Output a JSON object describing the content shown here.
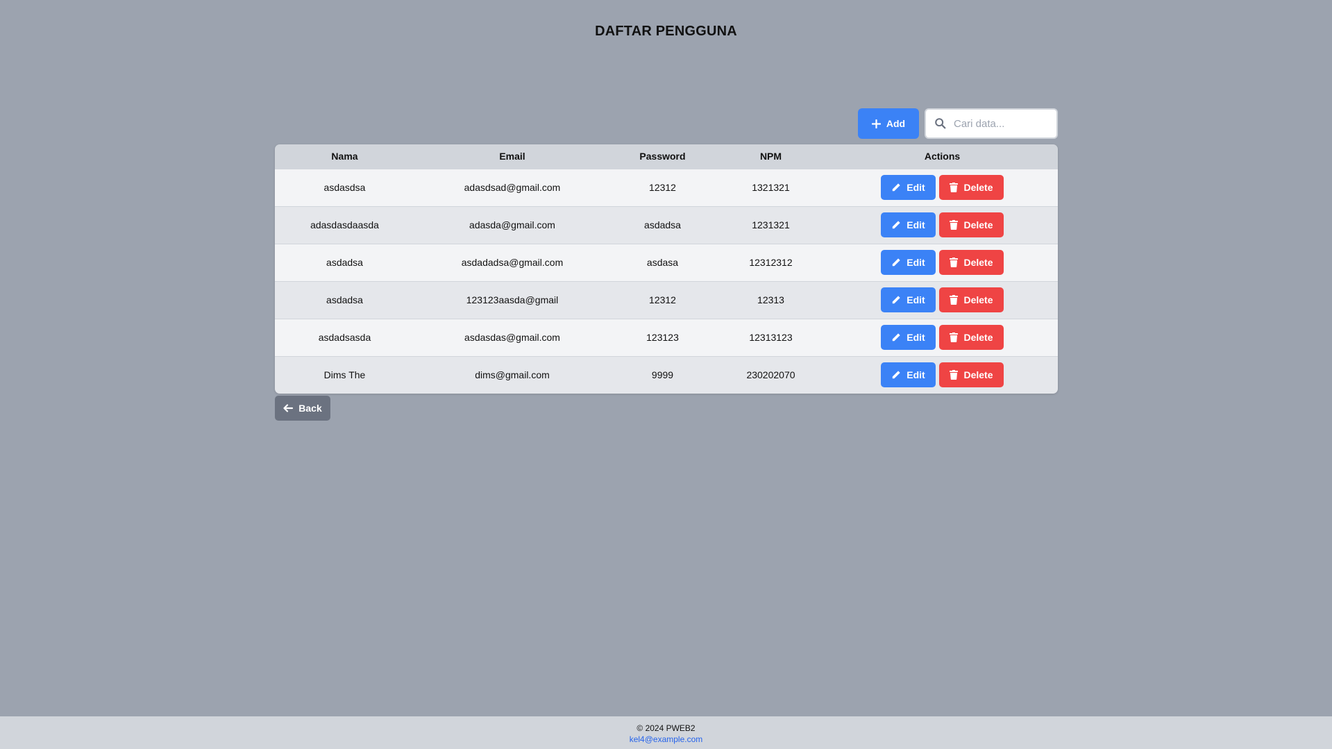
{
  "page": {
    "title": "DAFTAR PENGGUNA"
  },
  "toolbar": {
    "add_label": "Add",
    "search_placeholder": "Cari data...",
    "search_value": ""
  },
  "table": {
    "headers": [
      "Nama",
      "Email",
      "Password",
      "NPM",
      "Actions"
    ],
    "rows": [
      {
        "nama": "asdasdsa",
        "email": "adasdsad@gmail.com",
        "password": "12312",
        "npm": "1321321"
      },
      {
        "nama": "adasdasdaasda",
        "email": "adasda@gmail.com",
        "password": "asdadsa",
        "npm": "1231321"
      },
      {
        "nama": "asdadsa",
        "email": "asdadadsa@gmail.com",
        "password": "asdasa",
        "npm": "12312312"
      },
      {
        "nama": "asdadsa",
        "email": "123123aasda@gmail",
        "password": "12312",
        "npm": "12313"
      },
      {
        "nama": "asdadsasda",
        "email": "asdasdas@gmail.com",
        "password": "123123",
        "npm": "12313123"
      },
      {
        "nama": "Dims The",
        "email": "dims@gmail.com",
        "password": "9999",
        "npm": "230202070"
      }
    ],
    "edit_label": "Edit",
    "delete_label": "Delete"
  },
  "back_label": "Back",
  "footer": {
    "copyright": "© 2024 PWEB2",
    "email": "kel4@example.com"
  },
  "colors": {
    "background": "#9ca3af",
    "primary": "#3b82f6",
    "danger": "#ef4444",
    "secondary": "#6b7280"
  },
  "icons": {
    "add": "plus-icon",
    "search": "search-icon",
    "edit": "pencil-icon",
    "delete": "trash-icon",
    "back": "arrow-left-icon"
  }
}
